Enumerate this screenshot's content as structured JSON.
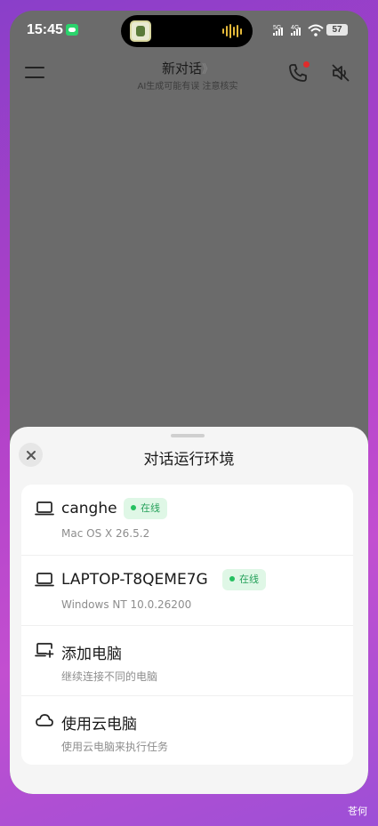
{
  "status_bar": {
    "time": "15:45",
    "signal_1": "5G",
    "signal_2": "4G",
    "battery": "57"
  },
  "header": {
    "title": "新对话",
    "title_chevron": "》",
    "subtitle": "AI生成可能有误 注意核实"
  },
  "sheet": {
    "title": "对话运行环境",
    "items": [
      {
        "icon": "laptop-icon",
        "title": "canghe",
        "badge": "在线",
        "subtitle": "Mac OS X 26.5.2"
      },
      {
        "icon": "laptop-icon",
        "title": "LAPTOP-T8QEME7G",
        "badge": "在线",
        "subtitle": "Windows NT 10.0.26200"
      },
      {
        "icon": "add-computer-icon",
        "title": "添加电脑",
        "subtitle": "继续连接不同的电脑"
      },
      {
        "icon": "cloud-icon",
        "title": "使用云电脑",
        "subtitle": "使用云电脑来执行任务"
      }
    ]
  },
  "colors": {
    "online_badge_bg": "#dff7e6",
    "online_badge_text": "#25a05a",
    "overlay": "#6b6b6b"
  },
  "watermark": "苍何"
}
